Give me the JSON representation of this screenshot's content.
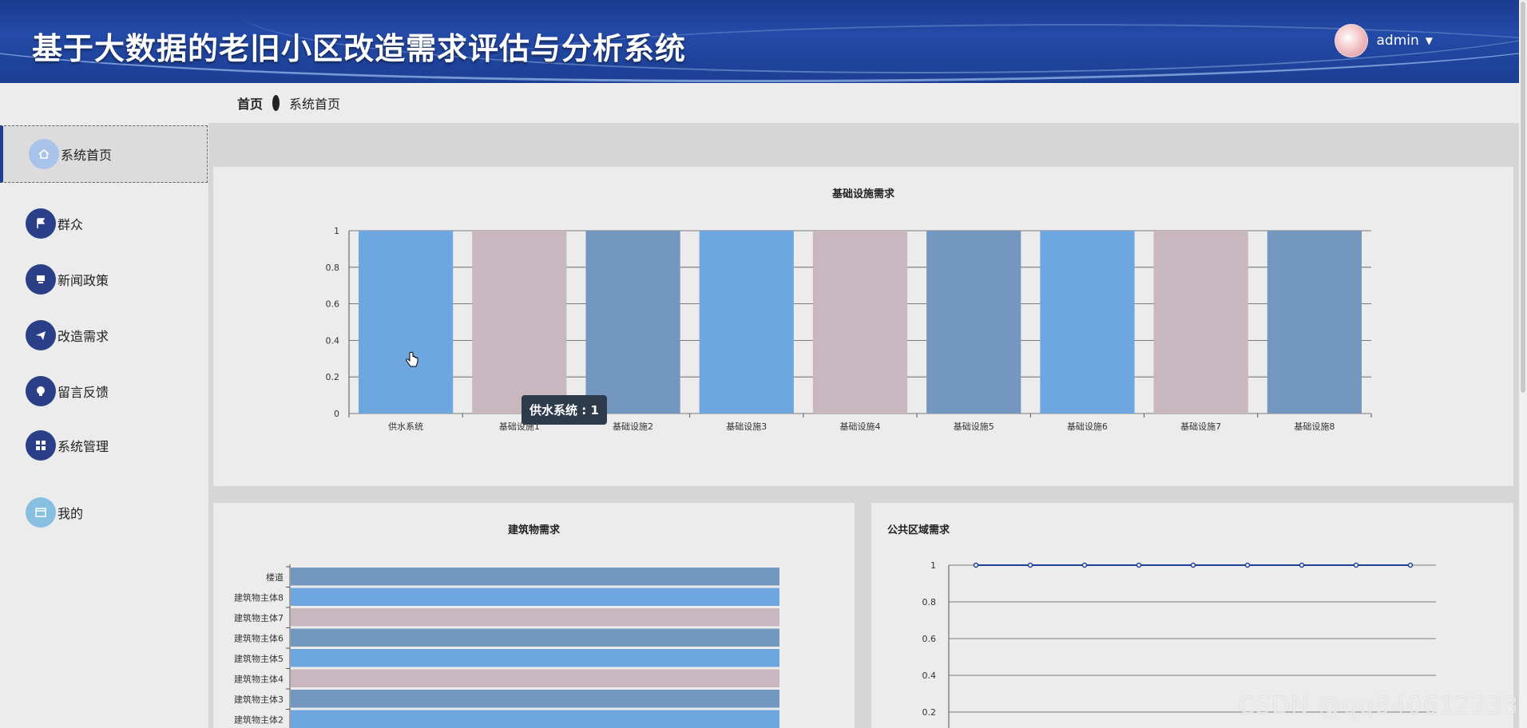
{
  "app": {
    "title": "基于大数据的老旧小区改造需求评估与分析系统"
  },
  "user": {
    "name": "admin"
  },
  "breadcrumb": {
    "home": "首页",
    "current": "系统首页"
  },
  "sidebar": {
    "items": [
      {
        "label": "系统首页",
        "icon": "home-icon"
      },
      {
        "label": "群众",
        "icon": "flag-icon"
      },
      {
        "label": "新闻政策",
        "icon": "monitor-icon"
      },
      {
        "label": "改造需求",
        "icon": "send-icon"
      },
      {
        "label": "留言反馈",
        "icon": "bulb-icon"
      },
      {
        "label": "系统管理",
        "icon": "grid-icon"
      },
      {
        "label": "我的",
        "icon": "card-icon"
      }
    ]
  },
  "charts": {
    "infra": {
      "title": "基础设施需求"
    },
    "building": {
      "title": "建筑物需求"
    },
    "public": {
      "title": "公共区域需求"
    }
  },
  "tooltip": {
    "text": "供水系统 : 1"
  },
  "watermark": "CSDN @qq840612233",
  "colors": {
    "blue": "#6ea6e0",
    "pink": "#c8b7be",
    "steel": "#7497c0",
    "header": "#1f3f93"
  },
  "chart_data": [
    {
      "type": "bar",
      "title": "基础设施需求",
      "categories": [
        "供水系统",
        "基础设施1",
        "基础设施2",
        "基础设施3",
        "基础设施4",
        "基础设施5",
        "基础设施6",
        "基础设施7",
        "基础设施8"
      ],
      "values": [
        1,
        1,
        1,
        1,
        1,
        1,
        1,
        1,
        1
      ],
      "ylim": [
        0,
        1
      ],
      "yticks": [
        "0",
        "0.2",
        "0.4",
        "0.6",
        "0.8",
        "1"
      ],
      "grid": true
    },
    {
      "type": "bar",
      "orientation": "horizontal",
      "title": "建筑物需求",
      "categories": [
        "楼道",
        "建筑物主体8",
        "建筑物主体7",
        "建筑物主体6",
        "建筑物主体5",
        "建筑物主体4",
        "建筑物主体3",
        "建筑物主体2"
      ],
      "values": [
        1,
        1,
        1,
        1,
        1,
        1,
        1,
        1
      ]
    },
    {
      "type": "line",
      "title": "公共区域需求",
      "values": [
        1,
        1,
        1,
        1,
        1,
        1,
        1,
        1,
        1
      ],
      "yticks": [
        "0.2",
        "0.4",
        "0.6",
        "0.8",
        "1"
      ],
      "grid": true
    }
  ]
}
